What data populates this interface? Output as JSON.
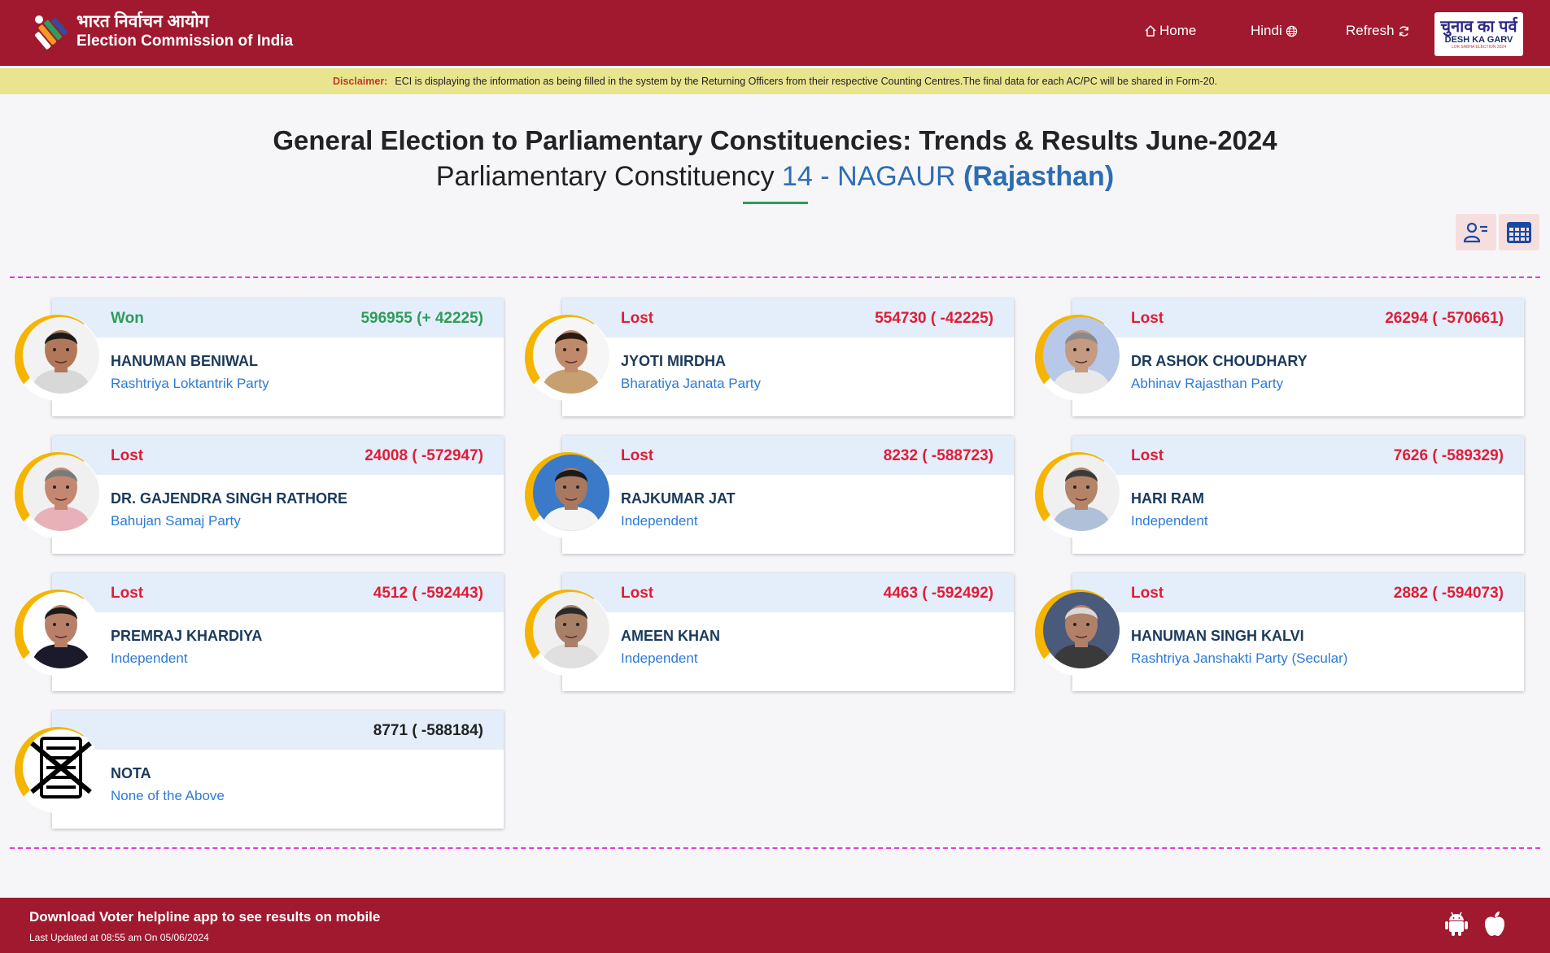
{
  "header": {
    "brand_hindi": "भारत निर्वाचन आयोग",
    "brand_english": "Election Commission of India",
    "nav": {
      "home": "Home",
      "hindi": "Hindi",
      "refresh": "Refresh"
    },
    "badge": {
      "hindi": "चुनाव का पर्व",
      "english": "DESH KA GARV",
      "sub": "LOK SABHA ELECTION 2024"
    },
    "color": "#a0192f"
  },
  "disclaimer": {
    "label": "Disclaimer:",
    "text": "ECI is displaying the information as being filled in the system by the Returning Officers from their respective Counting Centres.The final data for each AC/PC will be shared in Form-20."
  },
  "title": {
    "line1": "General Election to Parliamentary Constituencies: Trends & Results June-2024",
    "prefix": "Parliamentary Constituency",
    "constituency": "14 - NAGAUR",
    "state": "(Rajasthan)"
  },
  "candidates": [
    {
      "status": "Won",
      "votes": "596955 (+ 42225)",
      "name": "HANUMAN BENIWAL",
      "party": "Rashtriya Loktantrik Party",
      "skin": "#b07858",
      "hair": "#1a1a1a",
      "shirt": "#d8d8d8",
      "bg": "#f2f2f2"
    },
    {
      "status": "Lost",
      "votes": "554730 ( -42225)",
      "name": "JYOTI MIRDHA",
      "party": "Bharatiya Janata Party",
      "skin": "#c08a6a",
      "hair": "#2a1a12",
      "shirt": "#c8a070",
      "bg": "#f6f6f6"
    },
    {
      "status": "Lost",
      "votes": "26294 ( -570661)",
      "name": "DR ASHOK CHOUDHARY",
      "party": "Abhinav Rajasthan Party",
      "skin": "#c49a80",
      "hair": "#8a8a8a",
      "shirt": "#e8e8e8",
      "bg": "#b8c8e8"
    },
    {
      "status": "Lost",
      "votes": "24008 ( -572947)",
      "name": "DR. GAJENDRA SINGH RATHORE",
      "party": "Bahujan Samaj Party",
      "skin": "#c48870",
      "hair": "#7a7a7a",
      "shirt": "#e8b0b8",
      "bg": "#f0f0f0"
    },
    {
      "status": "Lost",
      "votes": "8232 ( -588723)",
      "name": "RAJKUMAR JAT",
      "party": "Independent",
      "skin": "#a87860",
      "hair": "#1a1a1a",
      "shirt": "#f4f4f4",
      "bg": "#3a7ac8"
    },
    {
      "status": "Lost",
      "votes": "7626 ( -589329)",
      "name": "HARI RAM",
      "party": "Independent",
      "skin": "#b48468",
      "hair": "#3a3a3a",
      "shirt": "#b0c0d8",
      "bg": "#f0f0f0"
    },
    {
      "status": "Lost",
      "votes": "4512 ( -592443)",
      "name": "PREMRAJ KHARDIYA",
      "party": "Independent",
      "skin": "#b88068",
      "hair": "#1a1a1a",
      "shirt": "#1a1a2a",
      "bg": "#ffffff"
    },
    {
      "status": "Lost",
      "votes": "4463 ( -592492)",
      "name": "AMEEN KHAN",
      "party": "Independent",
      "skin": "#a88068",
      "hair": "#2a2a2a",
      "shirt": "#e0e0e0",
      "bg": "#f0f0f0"
    },
    {
      "status": "Lost",
      "votes": "2882 ( -594073)",
      "name": "HANUMAN SINGH KALVI",
      "party": "Rashtriya Janshakti Party (Secular)",
      "skin": "#b08068",
      "hair": "#d8d8d8",
      "shirt": "#3a3a3a",
      "bg": "#4a5a7a"
    },
    {
      "status": "",
      "votes": "8771 ( -588184)",
      "name": "NOTA",
      "party": "None of the Above",
      "nota": true
    }
  ],
  "footer": {
    "main": "Download Voter helpline app to see results on mobile",
    "updated": "Last Updated at 08:55 am On 05/06/2024",
    "icons": [
      "android-icon",
      "apple-icon"
    ]
  },
  "colors": {
    "won": "#2e9c5a",
    "lost": "#e21c36",
    "accent": "#2d6db4",
    "divider": "#e040d0"
  }
}
